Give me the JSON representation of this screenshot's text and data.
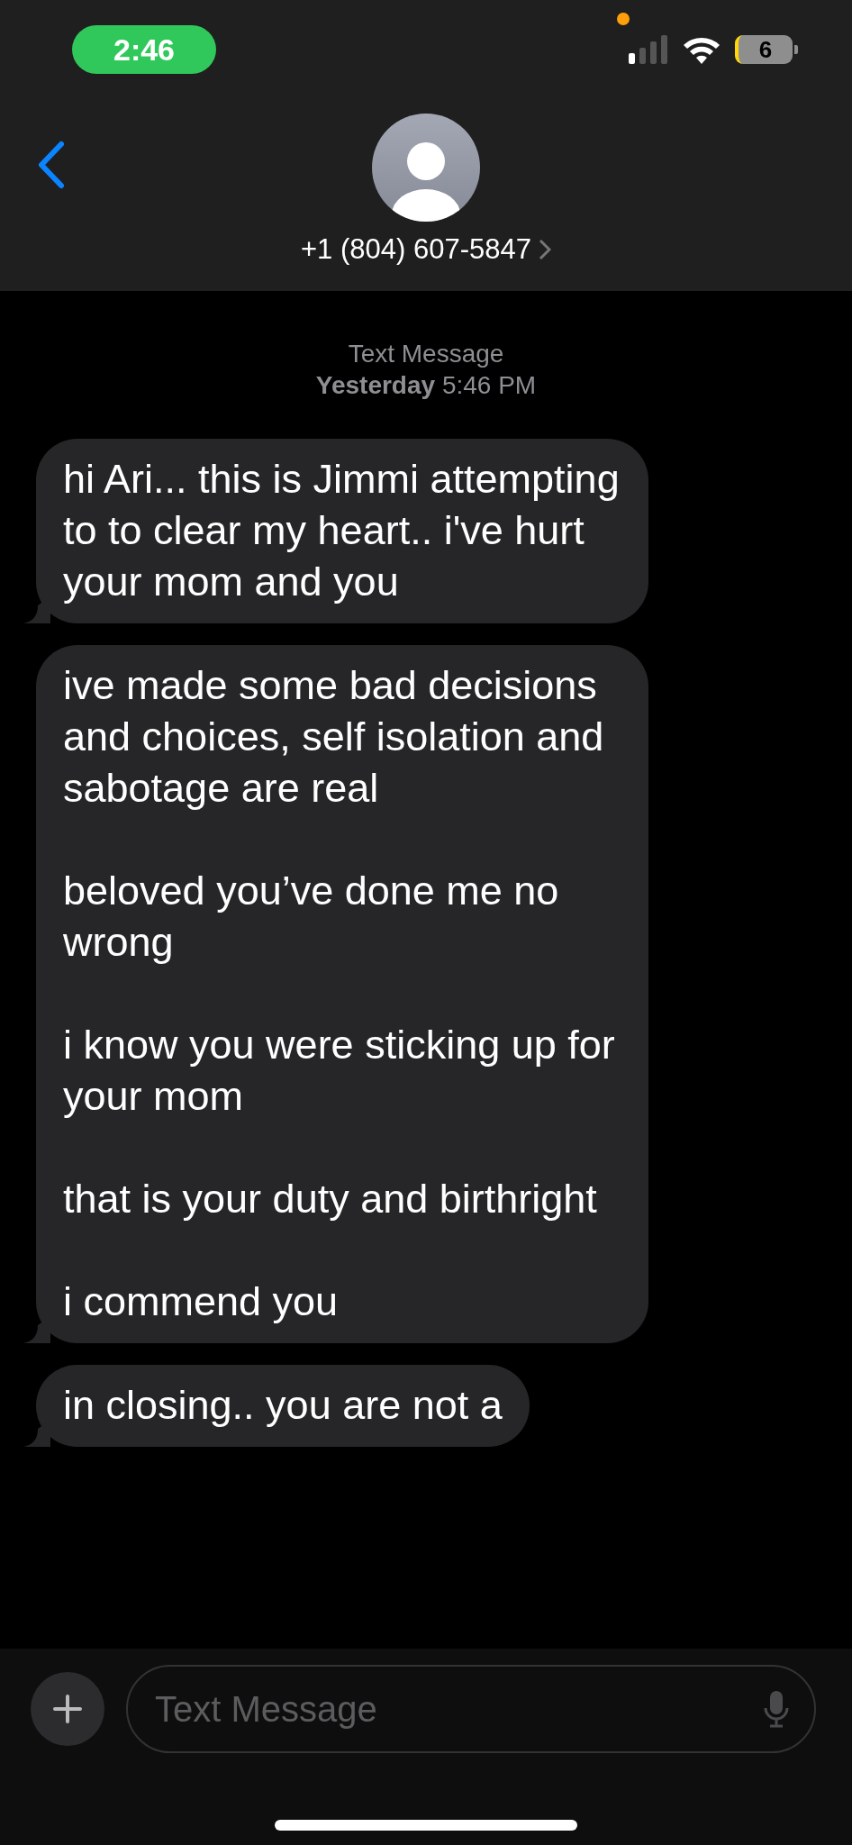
{
  "status_bar": {
    "time": "2:46",
    "battery": "6"
  },
  "header": {
    "contact": "+1 (804) 607-5847"
  },
  "conversation": {
    "service": "Text Message",
    "timestamp": "**Yesterday** 5:46 PM"
  },
  "messages": [
    {
      "paragraphs": [
        "hi Ari... this is Jimmi attempting to to clear my heart.. i've hurt your mom and you"
      ]
    },
    {
      "paragraphs": [
        "ive made some bad decisions and choices, self isolation and sabotage are real",
        "beloved you’ve done me no wrong",
        "i know you were sticking up for your mom",
        "that is your duty and birthright",
        "i commend you"
      ]
    },
    {
      "paragraphs": [
        "in closing.. you are not a"
      ]
    }
  ],
  "compose": {
    "placeholder": "Text Message"
  }
}
